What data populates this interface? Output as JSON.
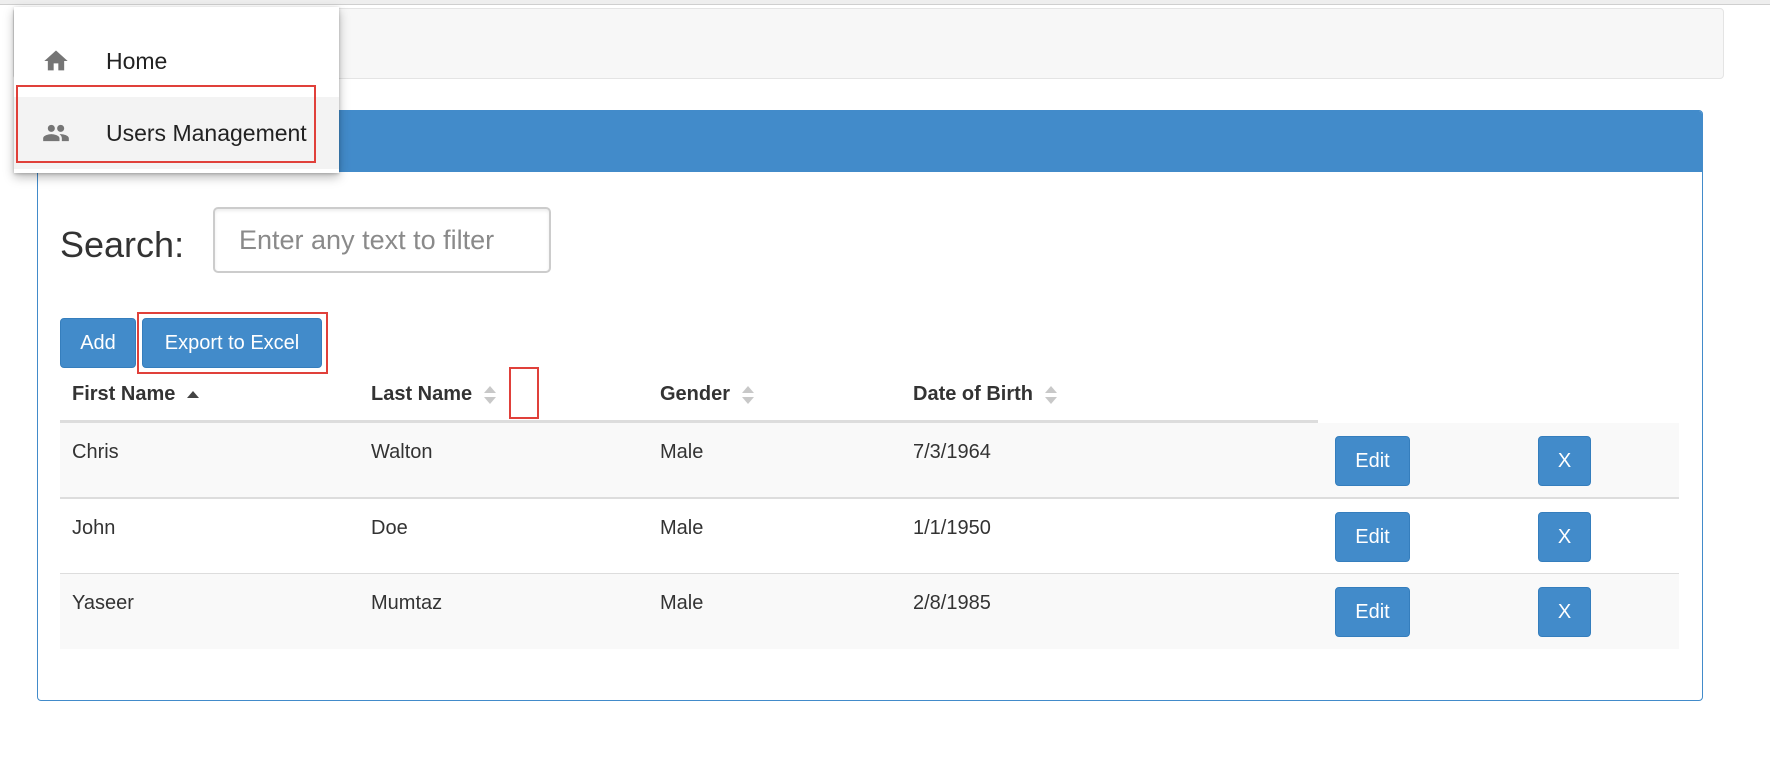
{
  "menu": {
    "items": [
      {
        "label": "Home",
        "icon": "home-icon"
      },
      {
        "label": "Users Management",
        "icon": "users-icon"
      }
    ]
  },
  "search": {
    "label": "Search:",
    "placeholder": "Enter any text to filter",
    "value": ""
  },
  "toolbar": {
    "add_label": "Add",
    "export_label": "Export to Excel"
  },
  "table": {
    "columns": [
      "First Name",
      "Last Name",
      "Gender",
      "Date of Birth"
    ],
    "sorted_column": "First Name",
    "sort_direction": "ascending",
    "edit_label": "Edit",
    "delete_label": "X",
    "rows": [
      [
        "Chris",
        "Walton",
        "Male",
        "7/3/1964"
      ],
      [
        "John",
        "Doe",
        "Male",
        "1/1/1950"
      ],
      [
        "Yaseer",
        "Mumtaz",
        "Male",
        "2/8/1985"
      ]
    ]
  },
  "colors": {
    "primary": "#428bca",
    "highlight": "#e0403a"
  }
}
